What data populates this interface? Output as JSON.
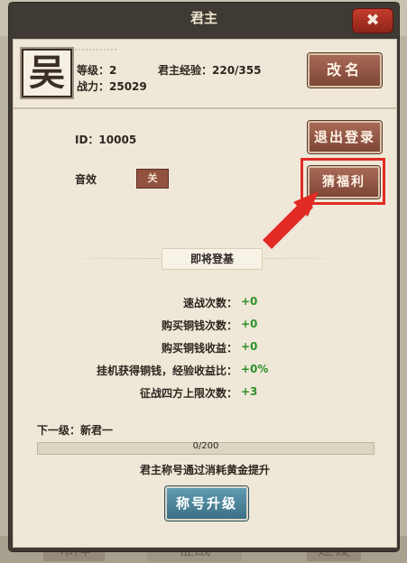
{
  "window": {
    "title": "君主",
    "close_icon": "✖"
  },
  "background": {
    "deco_text": "美化",
    "tabs": [
      "布阵",
      "征战",
      "建设"
    ]
  },
  "profile": {
    "avatar_char": "吴",
    "level_text": "等级：2",
    "exp_text": "君主经验：220/355",
    "power_text": "战力：25029",
    "rename_label": "改名"
  },
  "account": {
    "id_text": "ID：10005",
    "logout_label": "退出登录",
    "sound_label": "音效",
    "sound_toggle": "关",
    "guess_label": "猜福利"
  },
  "next_banner": "即将登基",
  "bonuses": [
    {
      "label": "速战次数：",
      "value": "+0"
    },
    {
      "label": "购买铜钱次数：",
      "value": "+0"
    },
    {
      "label": "购买铜钱收益：",
      "value": "+0"
    },
    {
      "label": "挂机获得铜钱，经验收益比：",
      "value": "+0%"
    },
    {
      "label": "征战四方上限次数：",
      "value": "+3"
    }
  ],
  "next_level": {
    "label": "下一级：新君一",
    "progress_text": "0/200",
    "progress_value": 0,
    "progress_max": 200,
    "hint": "君主称号通过消耗黄金提升"
  },
  "upgrade_label": "称号升级",
  "colors": {
    "highlight": "#e12b24",
    "bonus_green": "#2e8f27",
    "panel_dark": "#3f3a33"
  }
}
